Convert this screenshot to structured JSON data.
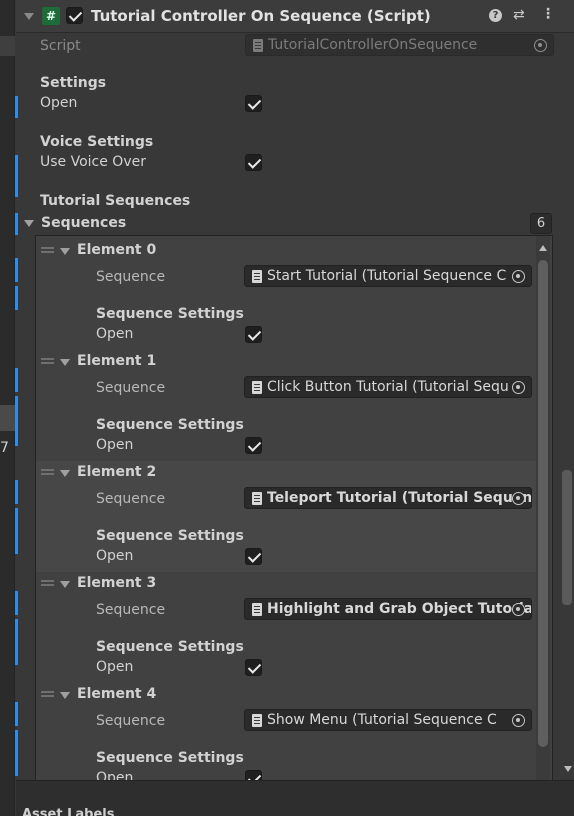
{
  "component": {
    "title": "Tutorial Controller On Sequence (Script)",
    "script_label": "Script",
    "script_value": "TutorialControllerOnSequence"
  },
  "settings": {
    "header": "Settings",
    "open_label": "Open",
    "open_checked": true
  },
  "voice": {
    "header": "Voice Settings",
    "use_voice_label": "Use Voice Over",
    "use_voice_checked": true
  },
  "tutorial": {
    "header": "Tutorial Sequences",
    "sequences_label": "Sequences",
    "count": "6"
  },
  "elements": [
    {
      "name": "Element 0",
      "sequence_label": "Sequence",
      "sequence_value": "Start Tutorial (Tutorial Sequence C",
      "settings_label": "Sequence Settings",
      "open_label": "Open",
      "open_checked": true
    },
    {
      "name": "Element 1",
      "sequence_label": "Sequence",
      "sequence_value": "Click Button Tutorial (Tutorial Sequ",
      "settings_label": "Sequence Settings",
      "open_label": "Open",
      "open_checked": true
    },
    {
      "name": "Element 2",
      "sequence_label": "Sequence",
      "sequence_value": "Teleport Tutorial (Tutorial Sequen",
      "settings_label": "Sequence Settings",
      "open_label": "Open",
      "open_checked": true
    },
    {
      "name": "Element 3",
      "sequence_label": "Sequence",
      "sequence_value": "Highlight and Grab Object Tutoria",
      "settings_label": "Sequence Settings",
      "open_label": "Open",
      "open_checked": true
    },
    {
      "name": "Element 4",
      "sequence_label": "Sequence",
      "sequence_value": "Show Menu (Tutorial Sequence C",
      "settings_label": "Sequence Settings",
      "open_label": "Open",
      "open_checked": true
    }
  ],
  "left_strip_number": "7",
  "bottom_text": "Asset Labels",
  "colors": {
    "accent_blue": "#2d8ee8",
    "background": "#383838",
    "field": "#2a2a2a"
  }
}
